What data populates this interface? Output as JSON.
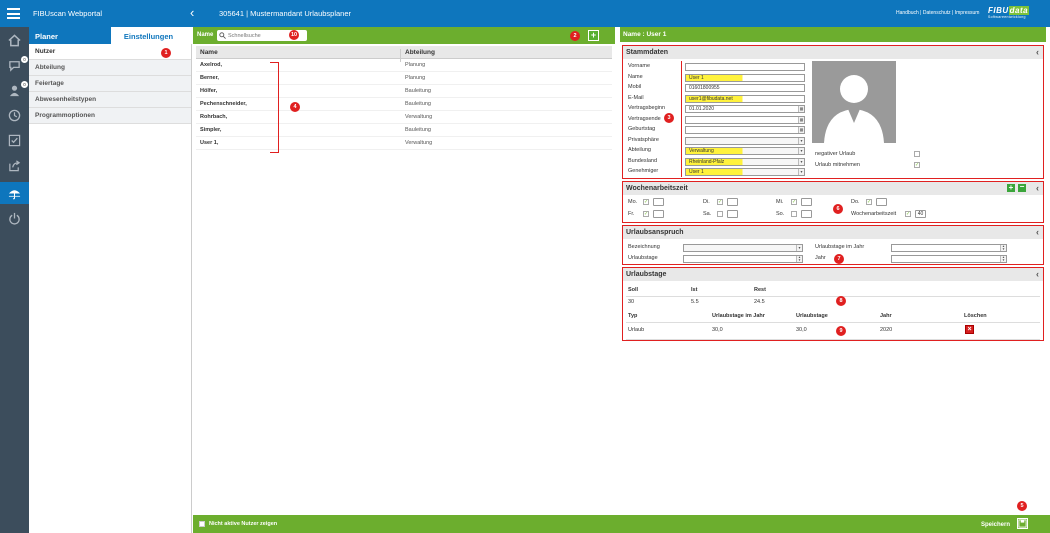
{
  "app": {
    "title": "FIBUscan Webportal",
    "context": "305641 | Mustermandant Urlaubsplaner",
    "links": "Handbuch | Datenschutz | Impressum",
    "logo_top_a": "FIBU",
    "logo_top_b": "data",
    "logo_sub": "Softwareentwicklung"
  },
  "colors": {
    "brand_blue": "#0e76bd",
    "accent_green": "#6cae2e",
    "marker_red": "#e02020",
    "highlight_yellow": "#fff23c",
    "rail_dark": "#3c4d5c"
  },
  "rail": {
    "items": [
      {
        "icon": "home-icon"
      },
      {
        "icon": "chat-icon",
        "badge": "0"
      },
      {
        "icon": "person-icon",
        "badge": "0"
      },
      {
        "icon": "clock-icon"
      },
      {
        "icon": "checklist-icon"
      },
      {
        "icon": "share-icon"
      },
      {
        "icon": "umbrella-icon",
        "active": true
      },
      {
        "icon": "power-icon"
      }
    ]
  },
  "nav": {
    "tabs": [
      "Planer",
      "Einstellungen"
    ],
    "active_tab": "Einstellungen",
    "items": [
      "Nutzer",
      "Abteilung",
      "Feiertage",
      "Abwesenheitstypen",
      "Programmoptionen"
    ],
    "selected": "Nutzer"
  },
  "users": {
    "filter_label": "Name",
    "search_placeholder": "Schnellsuche",
    "columns": [
      "Name",
      "Abteilung"
    ],
    "rows": [
      {
        "name": "Axelrod,",
        "dept": "Planung"
      },
      {
        "name": "Berner,",
        "dept": "Planung"
      },
      {
        "name": "Hölfer,",
        "dept": "Bauleitung"
      },
      {
        "name": "Pechenschneider,",
        "dept": "Bauleitung"
      },
      {
        "name": "Rohrbach,",
        "dept": "Verwaltung"
      },
      {
        "name": "Simpler,",
        "dept": "Bauleitung"
      },
      {
        "name": "User 1,",
        "dept": "Verwaltung"
      }
    ]
  },
  "bottom": {
    "inactive_label": "Nicht aktive Nutzer zeigen",
    "save_label": "Speichern"
  },
  "detail": {
    "header": "Name : User 1",
    "stammdaten": {
      "title": "Stammdaten",
      "fields": [
        {
          "label": "Vorname",
          "value": ""
        },
        {
          "label": "Name",
          "value": "User 1"
        },
        {
          "label": "Mobil",
          "value": "01601800955"
        },
        {
          "label": "E-Mail",
          "value": "user1@fibudata.net"
        },
        {
          "label": "Vertragsbeginn",
          "value": "01.01.2020"
        },
        {
          "label": "Vertragsende",
          "value": ""
        },
        {
          "label": "Geburtstag",
          "value": ""
        },
        {
          "label": "Privatsphäre",
          "value": ""
        },
        {
          "label": "Abteilung",
          "value": "Verwaltung"
        },
        {
          "label": "Bundesland",
          "value": "Rheinland-Pfalz"
        },
        {
          "label": "Genehmiger",
          "value": "User 1"
        }
      ],
      "checks": [
        {
          "label": "negativer Urlaub",
          "checked": false
        },
        {
          "label": "Urlaub mitnehmen",
          "checked": true
        }
      ]
    },
    "wochen": {
      "title": "Wochenarbeitszeit",
      "days": [
        {
          "label": "Mo.",
          "checked": true
        },
        {
          "label": "Di.",
          "checked": true
        },
        {
          "label": "Mi.",
          "checked": true
        },
        {
          "label": "Do.",
          "checked": true
        },
        {
          "label": "Fr.",
          "checked": true
        },
        {
          "label": "Sa.",
          "checked": false
        },
        {
          "label": "So.",
          "checked": false
        }
      ],
      "total_label": "Wochenarbeitszeit",
      "total_value": "40",
      "total_checked": true
    },
    "anspruch": {
      "title": "Urlaubsanspruch",
      "fields": [
        {
          "label": "Bezeichnung",
          "value": ""
        },
        {
          "label": "Urlaubstage im Jahr",
          "value": ""
        },
        {
          "label": "Urlaubstage",
          "value": ""
        },
        {
          "label": "Jahr",
          "value": ""
        }
      ]
    },
    "urlaubstage": {
      "title": "Urlaubstage",
      "summary_columns": [
        "Soll",
        "Ist",
        "Rest"
      ],
      "summary_values": [
        "30",
        "5.5",
        "24.5"
      ],
      "columns": [
        "Typ",
        "Urlaubstage im Jahr",
        "Urlaubstage",
        "Jahr",
        "Löschen"
      ],
      "rows": [
        {
          "typ": "Urlaub",
          "im_jahr": "30,0",
          "tage": "30,0",
          "jahr": "2020"
        }
      ]
    }
  },
  "markers": [
    "1",
    "2",
    "3",
    "4",
    "5",
    "6",
    "7",
    "8",
    "9",
    "10"
  ]
}
